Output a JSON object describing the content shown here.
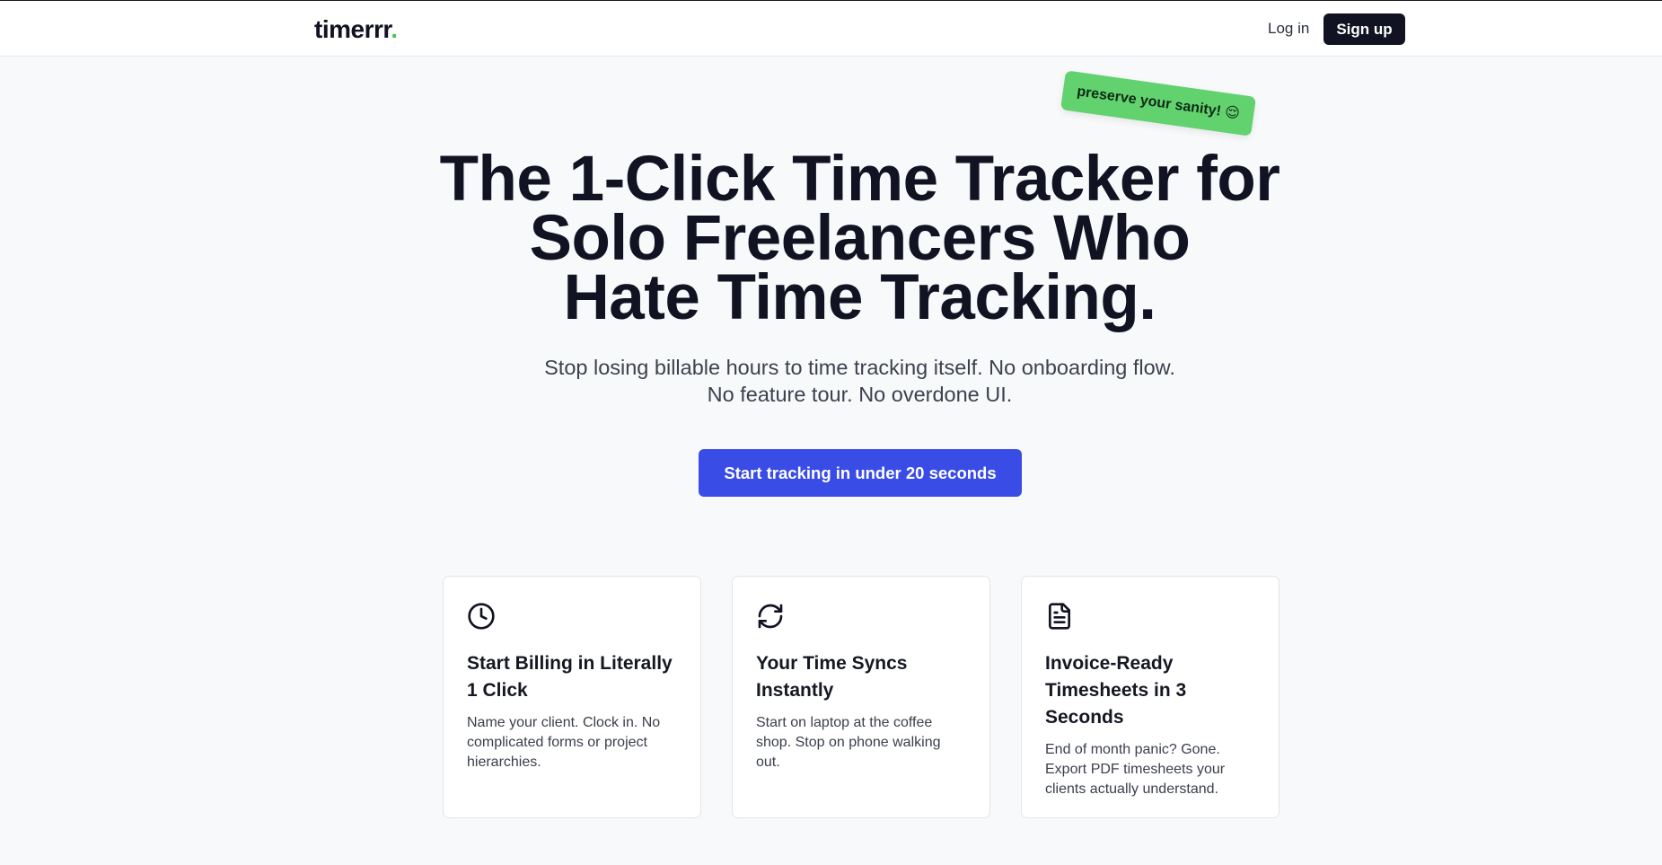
{
  "nav": {
    "logo_text": "timerrr",
    "logo_dot": ".",
    "login_label": "Log in",
    "signup_label": "Sign up"
  },
  "hero": {
    "sticker": "preserve your sanity! 😌",
    "headline_lines": [
      "The 1-Click Time Tracker for",
      "Solo Freelancers Who",
      "Hate Time Tracking."
    ],
    "subhead_lines": [
      "Stop losing billable hours to time tracking itself. No onboarding flow.",
      "No feature tour. No overdone UI."
    ],
    "cta_label": "Start tracking in under 20 seconds"
  },
  "features": [
    {
      "icon": "clock-icon",
      "title": "Start Billing in Literally 1 Click",
      "text": "Name your client. Clock in. No complicated forms or project hierarchies."
    },
    {
      "icon": "sync-icon",
      "title": "Your Time Syncs Instantly",
      "text": "Start on laptop at the coffee shop. Stop on phone walking out."
    },
    {
      "icon": "document-icon",
      "title": "Invoice-Ready Timesheets in 3 Seconds",
      "text": "End of month panic? Gone. Export PDF timesheets your clients actually understand."
    }
  ],
  "colors": {
    "brand_dark": "#111322",
    "accent_green": "#4cc35a",
    "cta_blue": "#3a4ce6",
    "background": "#f8f9fa"
  }
}
